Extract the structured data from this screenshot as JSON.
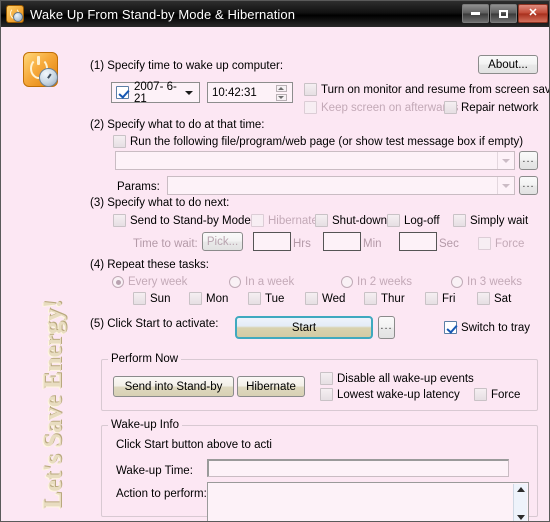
{
  "window": {
    "title": "Wake Up From Stand-by Mode & Hibernation",
    "icon": "app-power-clock-icon",
    "controls": {
      "minimize": "–",
      "maximize": "□",
      "close": "✕"
    }
  },
  "slogan": "Let's Save Energy!",
  "about_button": "About...",
  "step1": {
    "heading": "(1) Specify time to wake up computer:",
    "date_value": "2007- 6-21",
    "date_checked": true,
    "time_value": "10:42:31",
    "checkboxes": [
      {
        "label": "Turn on monitor and resume from screen saver",
        "checked": false,
        "enabled": true
      },
      {
        "label": "Keep screen on afterwards",
        "checked": false,
        "enabled": false
      },
      {
        "label": "Repair network",
        "checked": false,
        "enabled": true
      }
    ]
  },
  "step2": {
    "heading": "(2) Specify what to do at that time:",
    "run_checkbox": "Run the following file/program/web page (or show test message box if empty)",
    "run_checked": false,
    "file_value": "",
    "file_browse": "...",
    "params_label": "Params:",
    "params_value": "",
    "params_browse": "..."
  },
  "step3": {
    "heading": "(3) Specify what to do next:",
    "options": [
      {
        "label": "Send to Stand-by Mode",
        "checked": false,
        "enabled": true
      },
      {
        "label": "Hibernate",
        "checked": false,
        "enabled": false
      },
      {
        "label": "Shut-down",
        "checked": false,
        "enabled": true
      },
      {
        "label": "Log-off",
        "checked": false,
        "enabled": true
      },
      {
        "label": "Simply wait",
        "checked": false,
        "enabled": true
      }
    ],
    "time_to_wait_label": "Time to wait:",
    "pick_button": "Pick...",
    "hrs_value": "",
    "hrs_label": "Hrs",
    "min_value": "",
    "min_label": "Min",
    "sec_value": "",
    "sec_label": "Sec",
    "force_label": "Force",
    "force_checked": false
  },
  "step4": {
    "heading": "(4) Repeat these tasks:",
    "radios": [
      {
        "label": "Every week",
        "selected": true
      },
      {
        "label": "In a week",
        "selected": false
      },
      {
        "label": "In 2 weeks",
        "selected": false
      },
      {
        "label": "In 3 weeks",
        "selected": false
      }
    ],
    "days": [
      {
        "label": "Sun",
        "checked": false
      },
      {
        "label": "Mon",
        "checked": false
      },
      {
        "label": "Tue",
        "checked": false
      },
      {
        "label": "Wed",
        "checked": false
      },
      {
        "label": "Thur",
        "checked": false
      },
      {
        "label": "Fri",
        "checked": false
      },
      {
        "label": "Sat",
        "checked": false
      }
    ]
  },
  "step5": {
    "heading": "(5) Click Start to activate:",
    "start_button": "Start",
    "options_button": "...",
    "switch_to_tray": "Switch to tray",
    "switch_to_tray_checked": true
  },
  "perform_now": {
    "title": "Perform Now",
    "standby_button": "Send into Stand-by",
    "hibernate_button": "Hibernate",
    "disable_events": "Disable all wake-up events",
    "disable_events_checked": false,
    "lowest_latency": "Lowest wake-up latency",
    "lowest_latency_checked": false,
    "force": "Force",
    "force_checked": false
  },
  "wakeup_info": {
    "title": "Wake-up Info",
    "status_text": "Click Start button above to acti",
    "wakeup_time_label": "Wake-up Time:",
    "wakeup_time_value": "",
    "action_label": "Action to perform:",
    "action_value": ""
  },
  "colors": {
    "background": "#fce7f3",
    "accent_start_border": "#3fa9bf",
    "button_face": "#ded8bf",
    "slogan": "#e8dcc0"
  }
}
